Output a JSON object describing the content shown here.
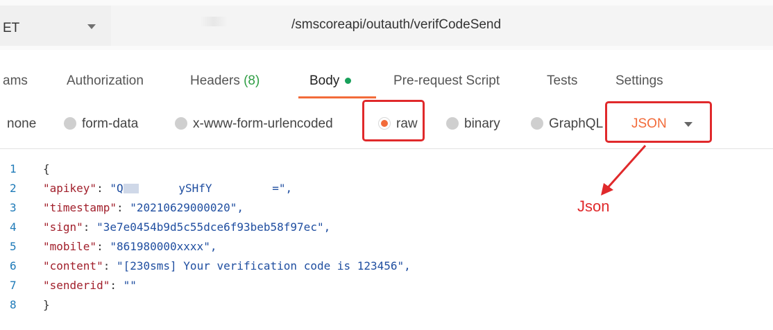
{
  "request": {
    "method": "ET",
    "url_path": "/smscoreapi/outauth/verifCodeSend"
  },
  "tabs": [
    {
      "label": "ams"
    },
    {
      "label": "Authorization"
    },
    {
      "label": "Headers",
      "count": "(8)"
    },
    {
      "label": "Body"
    },
    {
      "label": "Pre-request Script"
    },
    {
      "label": "Tests"
    },
    {
      "label": "Settings"
    }
  ],
  "body_types": {
    "none": "none",
    "form_data": "form-data",
    "urlencoded": "x-www-form-urlencoded",
    "raw": "raw",
    "binary": "binary",
    "graphql": "GraphQL",
    "selected": "raw",
    "format": "JSON"
  },
  "editor": {
    "line_numbers": [
      "1",
      "2",
      "3",
      "4",
      "5",
      "6",
      "7",
      "8"
    ],
    "open_brace": "{",
    "close_brace": "}",
    "fields": [
      {
        "key": "\"apikey\"",
        "value": "\"Q",
        "value_tail": "ySHfY",
        "value_end": "=\","
      },
      {
        "key": "\"timestamp\"",
        "value": "\"20210629000020\","
      },
      {
        "key": "\"sign\"",
        "value": "\"3e7e0454b9d5c55dce6f93beb58f97ec\","
      },
      {
        "key": "\"mobile\"",
        "value": "\"861980000xxxx\","
      },
      {
        "key": "\"content\"",
        "value": "\"[230sms] Your verification code is 123456\","
      },
      {
        "key": "\"senderid\"",
        "value": "\"\""
      }
    ]
  },
  "annotation": {
    "text": "Json",
    "color": "#e0292b"
  },
  "colors": {
    "accent": "#f26b3a",
    "highlight": "#e0292b",
    "json_key": "#a11f2b",
    "json_value": "#1f4ea0",
    "line_number": "#1e7ab8"
  }
}
